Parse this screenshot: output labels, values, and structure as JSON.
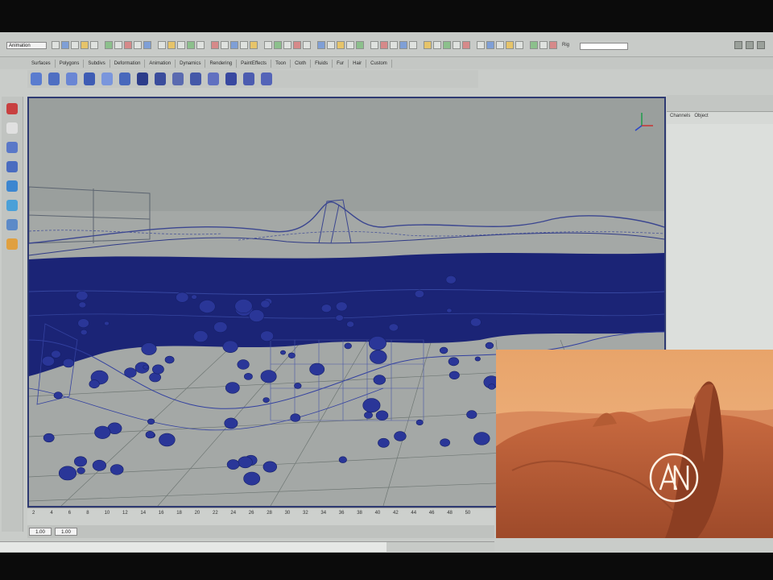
{
  "app": {
    "mode_menu": "Animation",
    "field_label": "Rig"
  },
  "menubar": {
    "shelf_tabs": [
      "Surfaces",
      "Polygons",
      "Subdivs",
      "Deformation",
      "Animation",
      "Dynamics",
      "Rendering",
      "PaintEffects",
      "Toon",
      "Cloth",
      "Fluids",
      "Fur",
      "Hair",
      "Custom"
    ]
  },
  "channel_box": {
    "tabs": [
      "Channels",
      "Object"
    ]
  },
  "timeline": {
    "ticks": [
      "2",
      "4",
      "6",
      "8",
      "10",
      "12",
      "14",
      "16",
      "18",
      "20",
      "22",
      "24",
      "26",
      "28",
      "30",
      "32",
      "34",
      "36",
      "38",
      "40",
      "42",
      "44",
      "46",
      "48",
      "50"
    ],
    "range_start": "1.00",
    "range_end": "1.00"
  },
  "render_preview": {
    "logo_text": "ANA"
  },
  "colors": {
    "viewport_bg": "#9aa09e",
    "wireframe": "#1d2b8a",
    "sky_sunset": "#e7a468",
    "terrain": "#c4673c"
  },
  "icons": {
    "toolbox": [
      "select-arrow-icon",
      "lasso-icon",
      "paint-select-icon",
      "move-icon",
      "rotate-icon",
      "scale-icon",
      "manipulator-icon",
      "last-tool-icon"
    ],
    "shelf": [
      "nurbs-sphere-icon",
      "nurbs-cube-icon",
      "nurbs-cylinder-icon",
      "nurbs-cone-icon",
      "nurbs-plane-icon",
      "nurbs-torus-icon",
      "circle-icon",
      "square-icon",
      "cv-curve-icon",
      "ep-curve-icon",
      "pencil-curve-icon",
      "arc-icon",
      "revolve-icon",
      "loft-icon"
    ]
  }
}
